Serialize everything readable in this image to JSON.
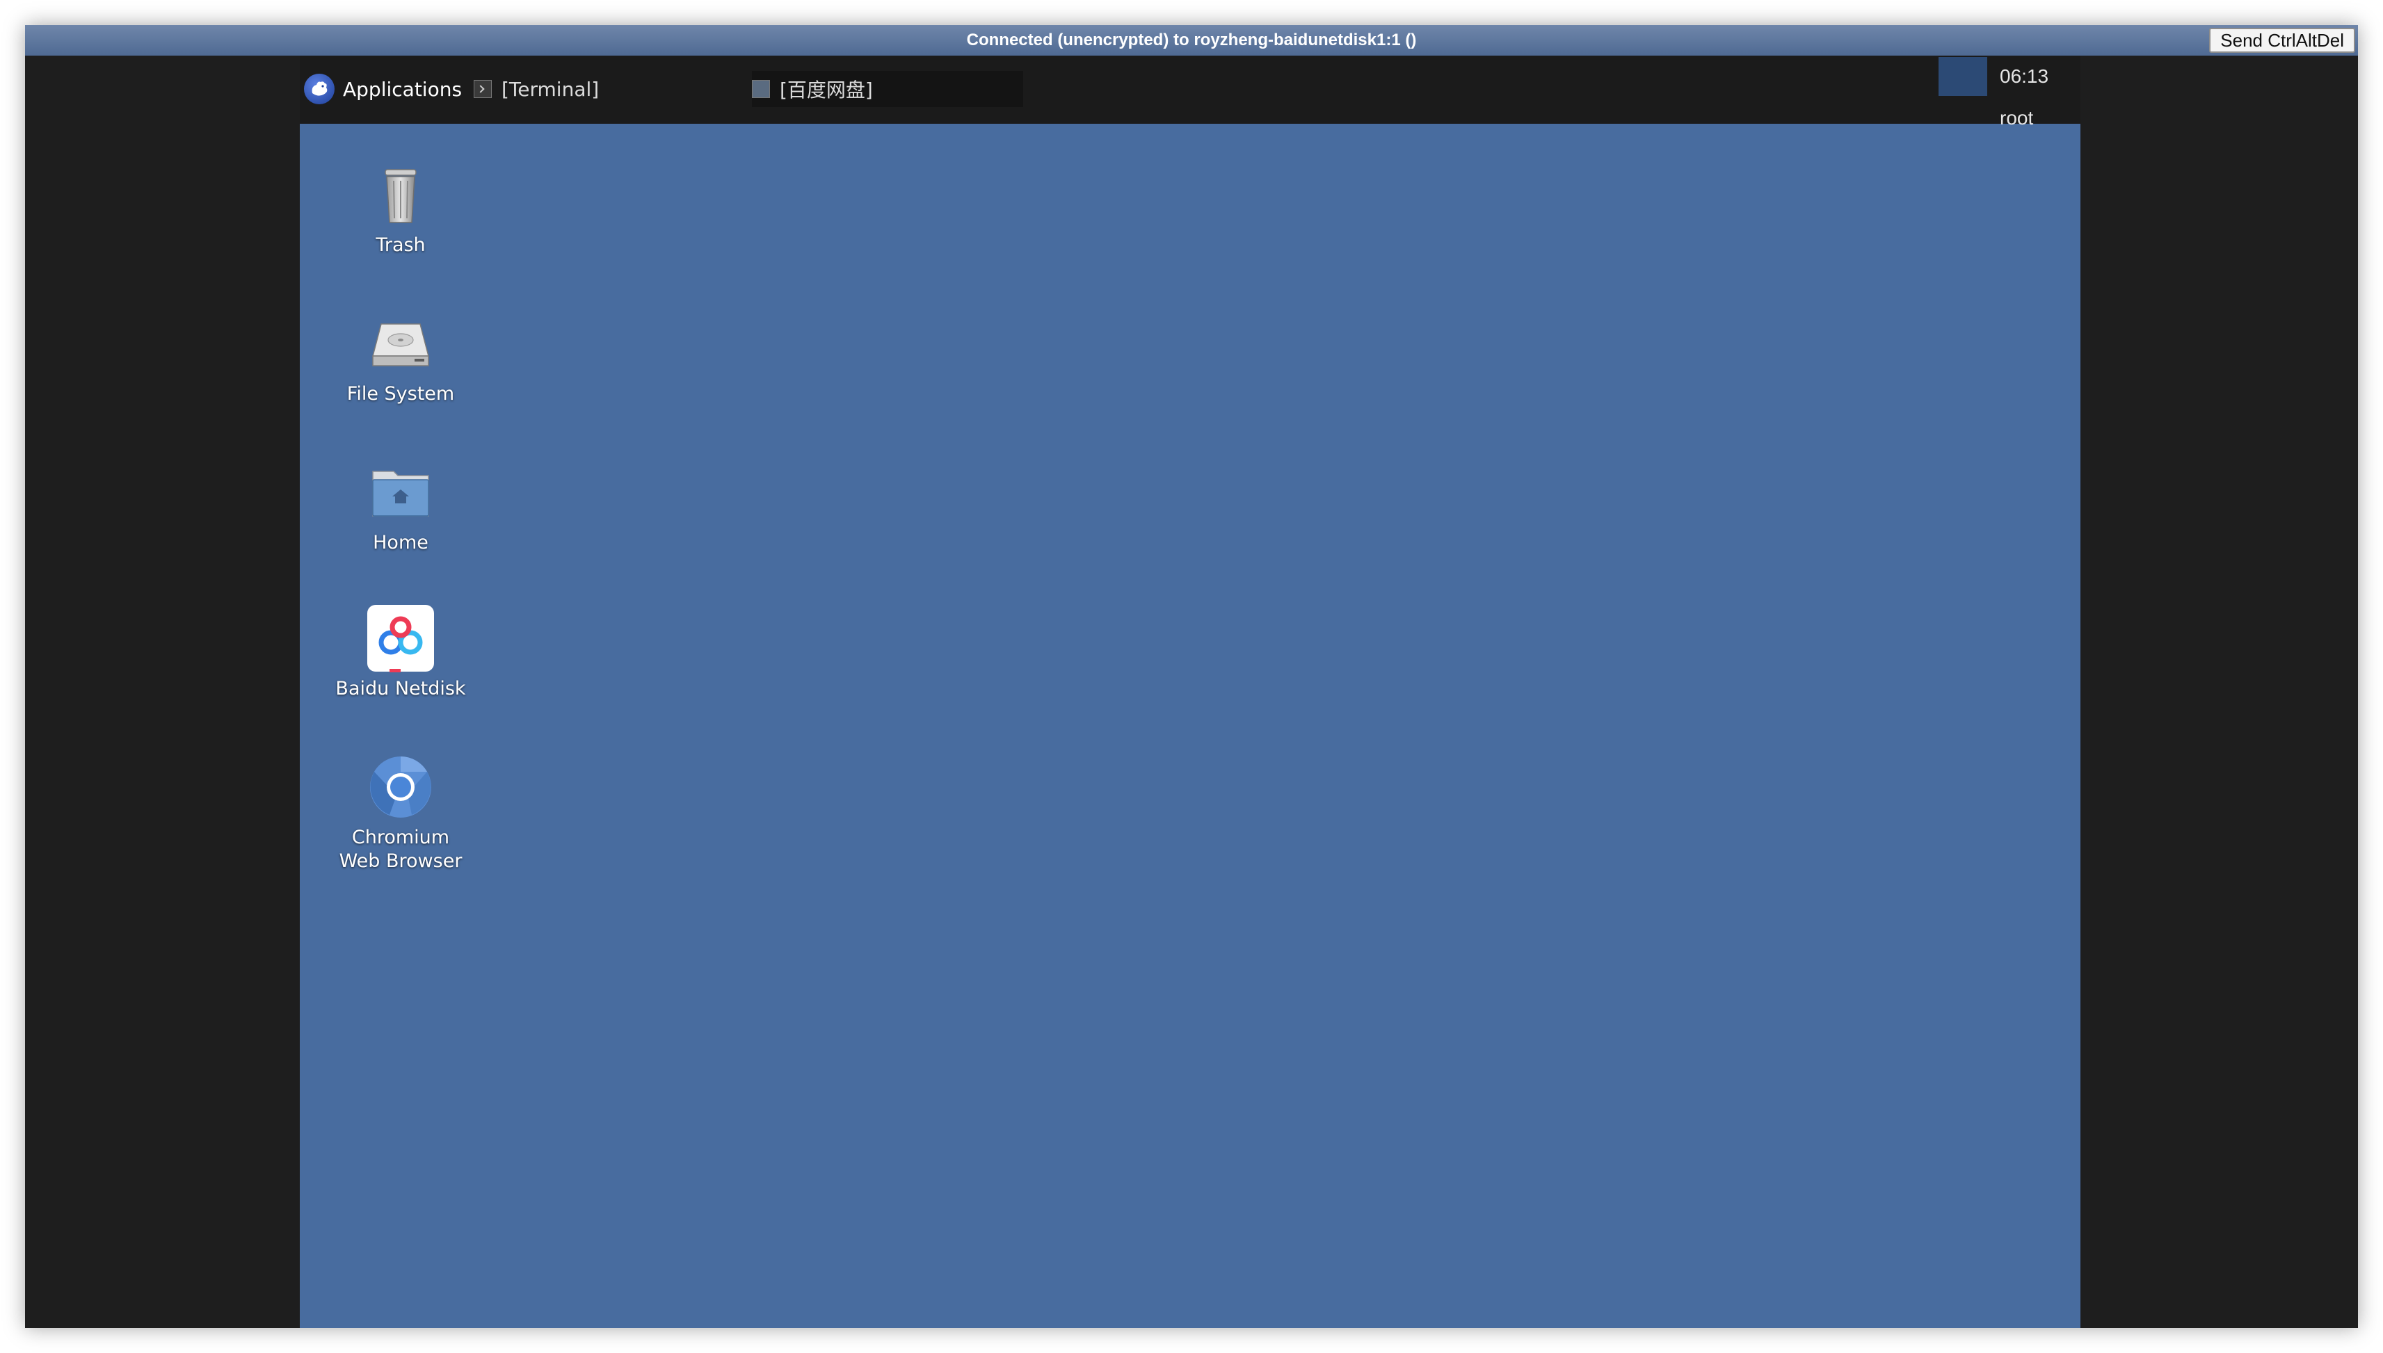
{
  "vnc": {
    "title": "Connected (unencrypted) to royzheng-baidunetdisk1:1 ()",
    "send_cad_label": "Send CtrlAltDel"
  },
  "panel": {
    "applications_label": "Applications",
    "tasks": [
      {
        "label": "[Terminal]",
        "icon": "terminal-icon"
      },
      {
        "label": "[百度网盘]",
        "icon": "baidu-netdisk-small-icon"
      }
    ],
    "clock_user": "06:13  root"
  },
  "desktop": {
    "icons": [
      {
        "label": "Trash",
        "icon": "trash-icon"
      },
      {
        "label": "File System",
        "icon": "hard-drive-icon"
      },
      {
        "label": "Home",
        "icon": "home-folder-icon"
      },
      {
        "label": "Baidu Netdisk",
        "icon": "baidu-netdisk-icon"
      },
      {
        "label_line1": "Chromium",
        "label_line2": "Web Browser",
        "icon": "chromium-icon"
      }
    ]
  },
  "colors": {
    "desktop_background": "#486c9f",
    "panel_background": "#1b1b1b",
    "titlebar": "#5a7399",
    "vnc_frame": "#1e1e1e"
  }
}
